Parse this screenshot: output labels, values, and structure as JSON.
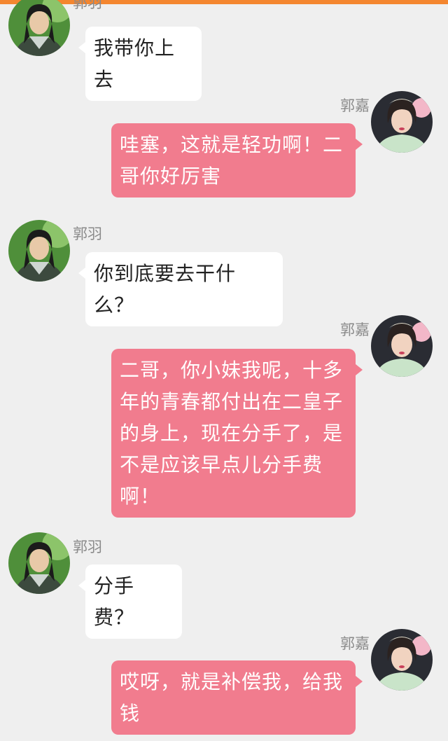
{
  "colors": {
    "background": "#efefef",
    "top_bar": "#f4862f",
    "incoming_bubble": "#ffffff",
    "outgoing_bubble": "#f17c8e",
    "name_text": "#8a8a8a"
  },
  "messages": [
    {
      "sender": "郭羽",
      "side": "left",
      "avatar": "male-avatar-icon",
      "text": "我带你上去"
    },
    {
      "sender": "郭嘉",
      "side": "right",
      "avatar": "female-avatar-icon",
      "text": "哇塞，这就是轻功啊！二哥你好厉害"
    },
    {
      "sender": "郭羽",
      "side": "left",
      "avatar": "male-avatar-icon",
      "text": "你到底要去干什么？"
    },
    {
      "sender": "郭嘉",
      "side": "right",
      "avatar": "female-avatar-icon",
      "text": "二哥，你小妹我呢，十多年的青春都付出在二皇子的身上，现在分手了，是不是应该早点儿分手费啊！"
    },
    {
      "sender": "郭羽",
      "side": "left",
      "avatar": "male-avatar-icon",
      "text": "分手费？"
    },
    {
      "sender": "郭嘉",
      "side": "right",
      "avatar": "female-avatar-icon",
      "text": "哎呀，就是补偿我，给我钱"
    }
  ]
}
